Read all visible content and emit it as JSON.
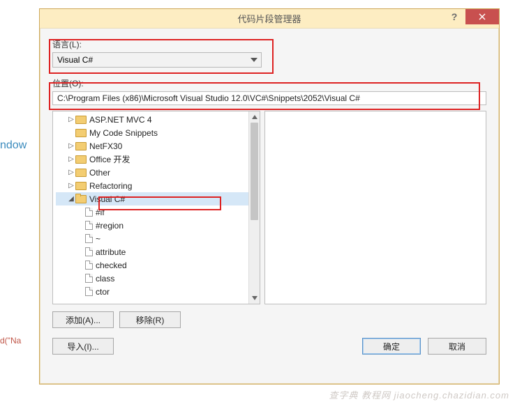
{
  "bg": {
    "text1": "ndow",
    "text2_pre": "d(\"",
    "text2_red": "Na"
  },
  "watermark": "查字典 教程网  jiaocheng.chazidian.com",
  "titlebar": {
    "title": "代码片段管理器",
    "help": "?",
    "close": "×"
  },
  "language": {
    "label": "语言(L):",
    "value": "Visual C#"
  },
  "location": {
    "label": "位置(O):",
    "value": "C:\\Program Files (x86)\\Microsoft Visual Studio 12.0\\VC#\\Snippets\\2052\\Visual C#"
  },
  "tree": {
    "items": [
      {
        "level": 1,
        "exp": "▷",
        "icon": "folder",
        "label": "ASP.NET MVC 4"
      },
      {
        "level": 1,
        "exp": "",
        "icon": "folder",
        "label": "My Code Snippets"
      },
      {
        "level": 1,
        "exp": "▷",
        "icon": "folder",
        "label": "NetFX30"
      },
      {
        "level": 1,
        "exp": "▷",
        "icon": "folder",
        "label": "Office 开发"
      },
      {
        "level": 1,
        "exp": "▷",
        "icon": "folder",
        "label": "Other"
      },
      {
        "level": 1,
        "exp": "▷",
        "icon": "folder",
        "label": "Refactoring"
      },
      {
        "level": 1,
        "exp": "◢",
        "icon": "folder-open",
        "label": "Visual C#",
        "selected": true
      },
      {
        "level": 2,
        "exp": "",
        "icon": "file",
        "label": "#if"
      },
      {
        "level": 2,
        "exp": "",
        "icon": "file",
        "label": "#region"
      },
      {
        "level": 2,
        "exp": "",
        "icon": "file",
        "label": "~"
      },
      {
        "level": 2,
        "exp": "",
        "icon": "file",
        "label": "attribute"
      },
      {
        "level": 2,
        "exp": "",
        "icon": "file",
        "label": "checked"
      },
      {
        "level": 2,
        "exp": "",
        "icon": "file",
        "label": "class"
      },
      {
        "level": 2,
        "exp": "",
        "icon": "file",
        "label": "ctor"
      }
    ]
  },
  "buttons": {
    "add": "添加(A)...",
    "remove": "移除(R)",
    "import": "导入(I)...",
    "ok": "确定",
    "cancel": "取消"
  }
}
